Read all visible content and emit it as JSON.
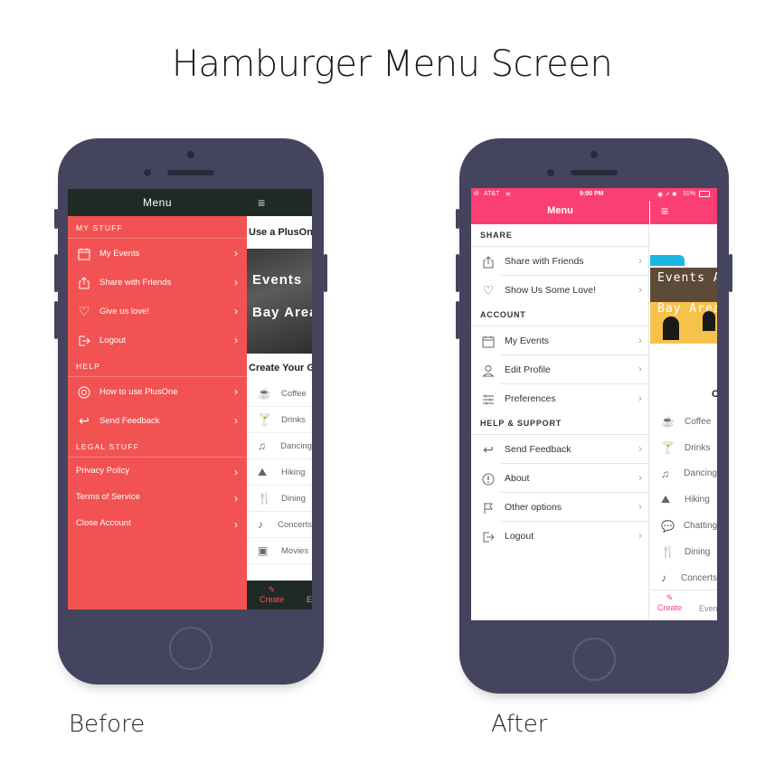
{
  "page": {
    "title": "Hamburger Menu Screen",
    "before_caption": "Before",
    "after_caption": "After"
  },
  "before": {
    "menu_title": "Menu",
    "sections": [
      {
        "label": "MY STUFF",
        "items": [
          "My Events",
          "Share with Friends",
          "Give us love!",
          "Logout"
        ]
      },
      {
        "label": "HELP",
        "items": [
          "How to use PlusOne",
          "Send Feedback"
        ]
      },
      {
        "label": "LEGAL STUFF",
        "items": [
          "Privacy Policy",
          "Terms of Service",
          "Close Account"
        ]
      }
    ],
    "content": {
      "promo": "Use a PlusOne",
      "hero_line1": "Events",
      "hero_line2": "Bay Area",
      "create_heading": "Create Your Group",
      "activities": [
        "Coffee",
        "Drinks",
        "Dancing",
        "Hiking",
        "Dining",
        "Concerts",
        "Movies"
      ],
      "tab_create": "Create",
      "tab_events": "E"
    },
    "colors": {
      "menu_bg": "#f25352",
      "header_bg": "#1f2a25"
    }
  },
  "after": {
    "status": {
      "carrier": "AT&T",
      "time": "9:00 PM",
      "battery": "31%"
    },
    "menu_title": "Menu",
    "sections": [
      {
        "label": "SHARE",
        "items": [
          "Share with Friends",
          "Show Us Some Love!"
        ]
      },
      {
        "label": "ACCOUNT",
        "items": [
          "My Events",
          "Edit Profile",
          "Preferences"
        ]
      },
      {
        "label": "HELP & SUPPORT",
        "items": [
          "Send Feedback",
          "About",
          "Other options",
          "Logout"
        ]
      }
    ],
    "content": {
      "hero_line1": "Events A",
      "hero_line2": "Bay Area",
      "create_heading": "C",
      "activities": [
        "Coffee",
        "Drinks",
        "Dancing",
        "Hiking",
        "Chatting",
        "Dining",
        "Concerts"
      ],
      "tab_create": "Create",
      "tab_events": "Events"
    },
    "colors": {
      "accent": "#fb3f74"
    }
  }
}
